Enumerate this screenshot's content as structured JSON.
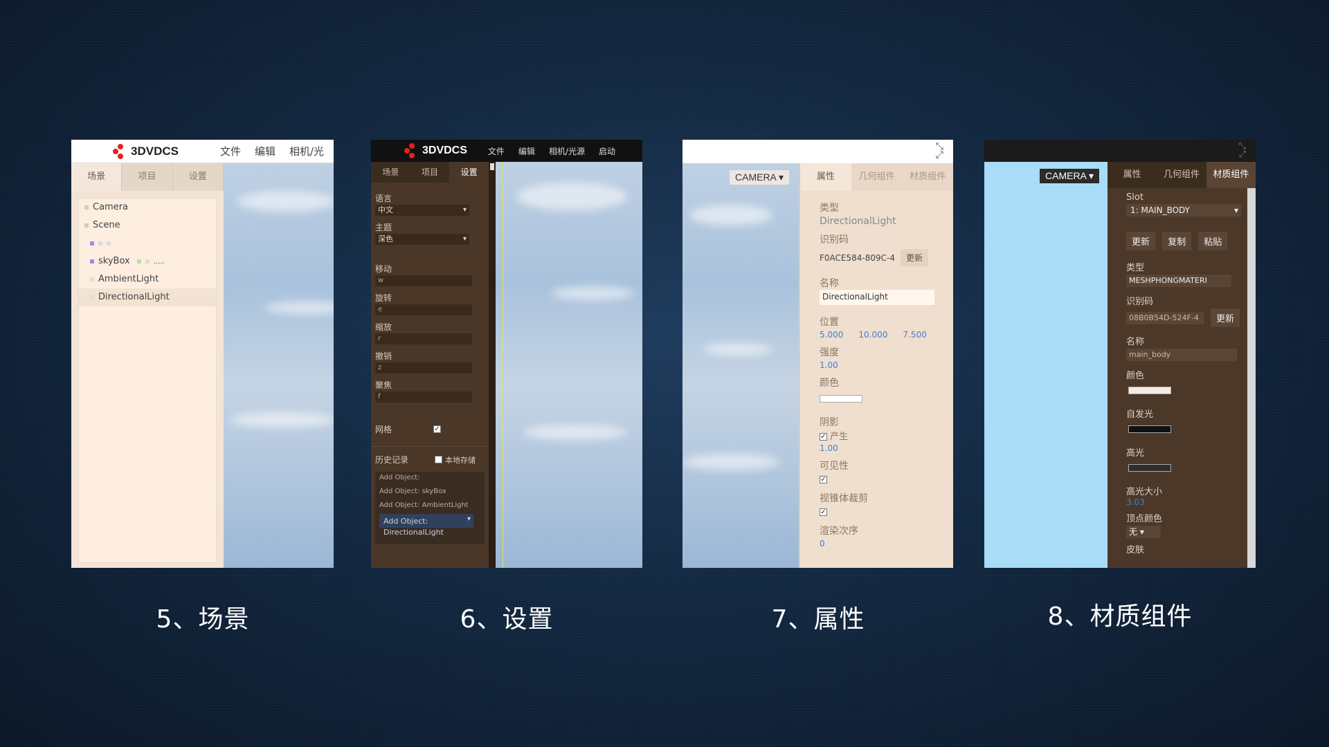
{
  "app": {
    "brand": "3DVDCS"
  },
  "captions": [
    "5、场景",
    "6、设置",
    "7、属性",
    "8、材质组件"
  ],
  "panel1": {
    "menu": [
      "文件",
      "编辑",
      "相机/光"
    ],
    "tabs": [
      "场景",
      "项目",
      "设置"
    ],
    "tree": [
      "Camera",
      "Scene",
      "",
      "skyBox",
      "AmbientLight",
      "DirectionalLight"
    ],
    "tree_suffix": "....."
  },
  "panel2": {
    "menu": [
      "文件",
      "编辑",
      "相机/光源",
      "启动"
    ],
    "tabs": [
      "场景",
      "项目",
      "设置"
    ],
    "language_label": "语言",
    "language_value": "中文",
    "theme_label": "主题",
    "theme_value": "深色",
    "move_label": "移动",
    "move_key": "w",
    "rotate_label": "旋转",
    "rotate_key": "e",
    "scale_label": "缩放",
    "scale_key": "r",
    "undo_label": "撤销",
    "undo_key": "z",
    "focus_label": "聚焦",
    "focus_key": "f",
    "grid_label": "网格",
    "history_label": "历史记录",
    "local_storage_label": "本地存储",
    "history": [
      "Add Object:",
      "Add Object: skyBox",
      "Add Object: AmbientLight",
      "Add Object: DirectionalLight"
    ]
  },
  "panel3": {
    "camera": "CAMERA",
    "tabs": [
      "属性",
      "几何组件",
      "材质组件"
    ],
    "type_label": "类型",
    "type_value": "DirectionalLight",
    "id_label": "识别码",
    "id_value": "F0ACE584-809C-4",
    "update": "更新",
    "name_label": "名称",
    "name_value": "DirectionalLight",
    "position_label": "位置",
    "position": [
      "5.000",
      "10.000",
      "7.500"
    ],
    "intensity_label": "强度",
    "intensity": "1.00",
    "color_label": "颜色",
    "shadow_label": "阴影",
    "shadow_cast": "产生",
    "shadow_value": "1.00",
    "visible_label": "可见性",
    "frustum_label": "视锥体裁剪",
    "render_order_label": "渲染次序",
    "render_order": "0"
  },
  "panel4": {
    "camera": "CAMERA",
    "tabs": [
      "属性",
      "几何组件",
      "材质组件"
    ],
    "slot_label": "Slot",
    "slot_value": "1: MAIN_BODY",
    "buttons": [
      "更新",
      "复制",
      "粘贴"
    ],
    "type_label": "类型",
    "type_value": "MESHPHONGMATERI",
    "id_label": "识别码",
    "id_value": "08B0B54D-524F-4",
    "update": "更新",
    "name_label": "名称",
    "name_value": "main_body",
    "color_label": "颜色",
    "emissive_label": "自发光",
    "specular_label": "高光",
    "shininess_label": "高光大小",
    "shininess": "3.03",
    "vertex_color_label": "顶点颜色",
    "vertex_color": "无",
    "skin_label": "皮肤"
  }
}
